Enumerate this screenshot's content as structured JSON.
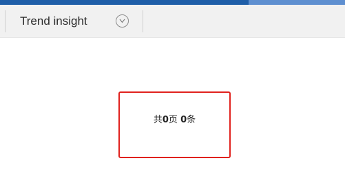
{
  "colors": {
    "top_strip": "#1f5ea8",
    "toolbar_bg": "#f1f1f1",
    "highlight_border": "#e0211d"
  },
  "toolbar": {
    "title": "Trend insight",
    "collapse_icon": "chevron-down-icon"
  },
  "pager": {
    "prefix": "共",
    "page_count": "0",
    "page_unit": "页",
    "item_count": "0",
    "item_unit": "条"
  }
}
